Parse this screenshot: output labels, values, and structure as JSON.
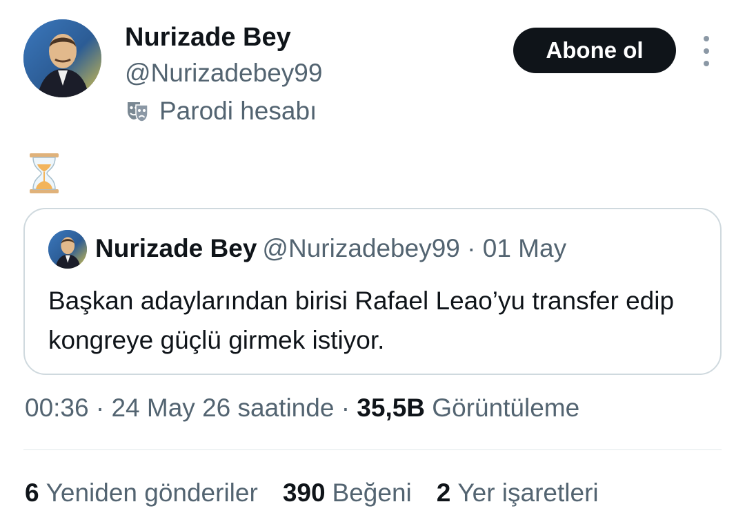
{
  "author": {
    "display_name": "Nurizade Bey",
    "handle": "@Nurizadebey99",
    "parody_label": "Parodi hesabı"
  },
  "actions": {
    "follow_label": "Abone ol"
  },
  "tweet": {
    "text_icon": "hourglass-icon"
  },
  "quote": {
    "display_name": "Nurizade Bey",
    "meta": "@Nurizadebey99 · 01 May",
    "text": "Başkan adaylarından birisi Rafael Leao’yu transfer edip kongreye güçlü girmek istiyor."
  },
  "timestamp": {
    "time_date": "00:36 · 24 May 26 saatinde · ",
    "views_count": "35,5B",
    "views_label": " Görüntüleme"
  },
  "stats": {
    "reposts_count": "6",
    "reposts_label": "Yeniden gönderiler",
    "likes_count": "390",
    "likes_label": "Beğeni",
    "bookmarks_count": "2",
    "bookmarks_label": "Yer işaretleri"
  },
  "colors": {
    "text_primary": "#0f1419",
    "text_secondary": "#536471",
    "border": "#cfd9de",
    "button_bg": "#0f1419"
  }
}
